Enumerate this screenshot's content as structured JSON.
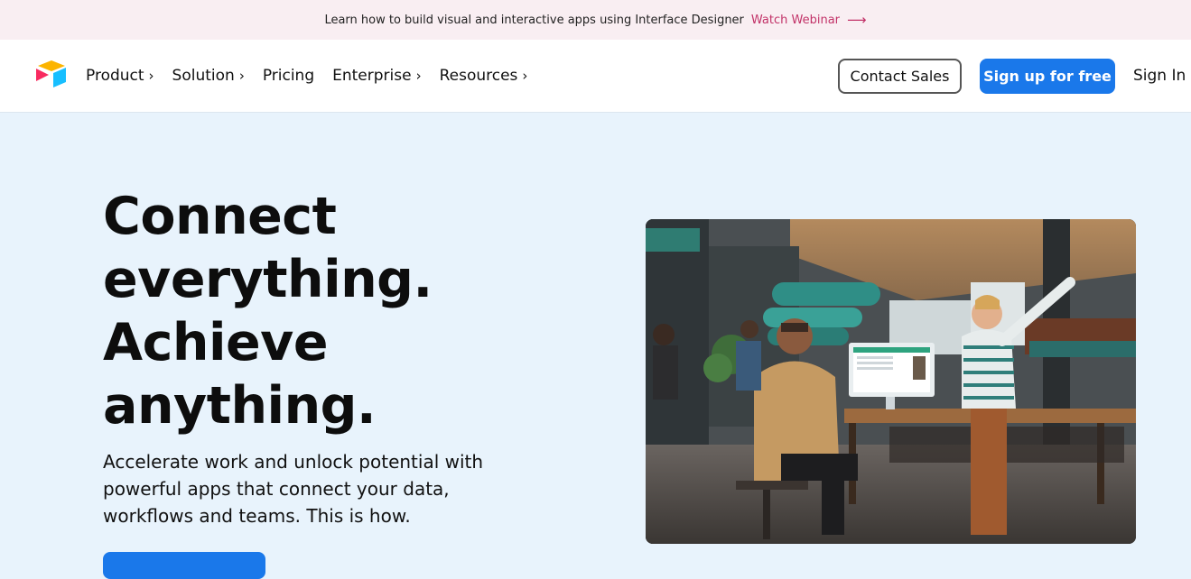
{
  "banner": {
    "message": "Learn how to build visual and interactive apps using Interface Designer",
    "link_label": "Watch Webinar",
    "link_arrow_icon": "long-arrow-right-icon",
    "link_color": "#c23268",
    "background": "#f9eef2"
  },
  "nav": {
    "logo_icon": "airtable-logo-icon",
    "items": [
      {
        "label": "Product",
        "has_dropdown": true
      },
      {
        "label": "Solution",
        "has_dropdown": true
      },
      {
        "label": "Pricing",
        "has_dropdown": false
      },
      {
        "label": "Enterprise",
        "has_dropdown": true
      },
      {
        "label": "Resources",
        "has_dropdown": true
      }
    ],
    "chevron": "›",
    "contact_sales": "Contact Sales",
    "sign_up": "Sign up for free",
    "sign_in": "Sign In"
  },
  "hero": {
    "title_lines": [
      "Connect",
      "everything.",
      "Achieve",
      "anything."
    ],
    "subtitle_lines": [
      "Accelerate work and unlock potential with",
      "powerful apps that connect your data,",
      "workflows and teams. This is how."
    ],
    "photo": "photo of people working in a bright warehouse studio around a desktop computer"
  },
  "colors": {
    "accent": "#1a78ea",
    "hero_background": "#e8f3fc",
    "nav_background": "#ffffff"
  }
}
